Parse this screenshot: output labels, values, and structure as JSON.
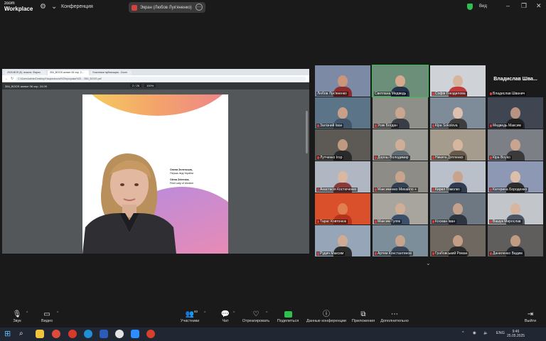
{
  "app": {
    "brand_top": "zoom",
    "brand_bottom": "Workplace",
    "conference_label": "Конференция"
  },
  "share_pill": {
    "label": "Экран (Любов Лук'яненко)"
  },
  "window": {
    "view_label": "Вид"
  },
  "browser": {
    "tabs": [
      "2025.BOS (5). вчасно. Фархи",
      "354_BOOS.затвит 06 спр. 2...",
      "Участники публикации - Zoom"
    ],
    "url": "C:/Users/admin/Desktop/Національна%20програма%20…/354_BOOS.pdf",
    "pdf_title": "354_BOOS затвит 06 спр. 24.09",
    "pdf_page": "2 / 26",
    "pdf_zoom": "100%"
  },
  "pdf_caption": {
    "name_ua": "Олена Зеленська,",
    "title_ua": "Перша леді України",
    "name_en": "Olena Zelenska,",
    "title_en": "First Lady of Ukraine"
  },
  "participants": [
    {
      "name": "Любов Лук'яненко",
      "muted": false,
      "bg": "#7d8aa5",
      "skin": "#c9957b",
      "shirt": "#8d2a2a"
    },
    {
      "name": "Светлана Медведь",
      "muted": false,
      "bg": "#6c8f79",
      "skin": "#d4a98e",
      "shirt": "#233149",
      "active": true
    },
    {
      "name": "Софія Гнездилова",
      "muted": true,
      "bg": "#cfd3d8",
      "skin": "#d8b49c",
      "shirt": "#c23b3b"
    },
    {
      "name": "Владислав Шва...",
      "full": "Владислав Шванич",
      "muted": true,
      "nameonly": true
    },
    {
      "name": "Залізний Іван",
      "muted": true,
      "bg": "#5c7488",
      "skin": "#c8a08a",
      "shirt": "#40546a"
    },
    {
      "name": "Усик Богдан",
      "muted": true,
      "bg": "#8f8f8a",
      "skin": "#caa690",
      "shirt": "#3a3d46"
    },
    {
      "name": "Кіра Sokolova",
      "muted": true,
      "bg": "#7e8b98",
      "skin": "#dcc0ad",
      "shirt": "#3d3d3d"
    },
    {
      "name": "Медведь Максим",
      "muted": true,
      "bg": "#3f4652",
      "skin": "#b89382",
      "shirt": "#222"
    },
    {
      "name": "Лутченко Ігор",
      "muted": true,
      "bg": "#5d5a55",
      "skin": "#c09a80",
      "shirt": "#2a2a2a"
    },
    {
      "name": "Дорош Володимир",
      "muted": true,
      "bg": "#9a9c95",
      "skin": "#cfae98",
      "shirt": "#5e6b73"
    },
    {
      "name": "Никита Дятленко",
      "muted": true,
      "bg": "#a59c8e",
      "skin": "#d6b69e",
      "shirt": "#665a4a"
    },
    {
      "name": "Кіра Boyko",
      "muted": true,
      "bg": "#7d7f87",
      "skin": "#c9a48f",
      "shirt": "#3a3a3a"
    },
    {
      "name": "Анастасія Костюченко",
      "muted": true,
      "bg": "#b0b6c2",
      "skin": "#d9b8a2",
      "shirt": "#8b3a3a"
    },
    {
      "name": "Максименко Михайло +",
      "muted": true,
      "bg": "#8e8c86",
      "skin": "#c9a48d",
      "shirt": "#314055"
    },
    {
      "name": "Кирил Гомолко",
      "muted": true,
      "bg": "#b9c0c9",
      "skin": "#caa38d",
      "shirt": "#2f3c52"
    },
    {
      "name": "Катерина Бороденко",
      "muted": true,
      "bg": "#8d99b4",
      "skin": "#dcbfab",
      "shirt": "#2d2d2d"
    },
    {
      "name": "Тарас Ковтонюк",
      "muted": true,
      "bg": "#d9502b",
      "skin": "#e07f4f",
      "shirt": "#b4331a"
    },
    {
      "name": "Максим Гуляк",
      "muted": true,
      "bg": "#a7a59e",
      "skin": "#cfae98",
      "shirt": "#3b4f6a"
    },
    {
      "name": "Косман Іван",
      "muted": true,
      "bg": "#6d7883",
      "skin": "#c5a08a",
      "shirt": "#2e3440"
    },
    {
      "name": "Вашук Мирослав",
      "muted": true,
      "bg": "#c2c6ca",
      "skin": "#d7b5a0",
      "shirt": "#4b5563"
    },
    {
      "name": "Рудич Максим",
      "muted": true,
      "bg": "#96a6b8",
      "skin": "#cfab93",
      "shirt": "#2c2c2c"
    },
    {
      "name": "Артем Константинов",
      "muted": true,
      "bg": "#7b8e99",
      "skin": "#c6a38c",
      "shirt": "#374456"
    },
    {
      "name": "Грабовський Роман",
      "muted": true,
      "bg": "#6e6860",
      "skin": "#c49d86",
      "shirt": "#2b2b2b"
    },
    {
      "name": "Даниленко Вадим",
      "muted": true,
      "bg": "#5f5e5c",
      "skin": "#c19a83",
      "shirt": "#23272e"
    }
  ],
  "toolbar": {
    "audio": "Звук",
    "video": "Видео",
    "participants": "Участники",
    "participants_count": "60",
    "chat": "Чат",
    "react": "Отреагировать",
    "share": "Поделиться",
    "info": "Данные конференции",
    "apps": "Приложения",
    "more": "Дополнительно",
    "leave": "Выйти"
  },
  "taskbar": {
    "lang": "ENG",
    "time": "9:46",
    "date": "25.05.2025"
  },
  "colors": {
    "share_green": "#2fbf4e",
    "mute_red": "#e23a3a",
    "bg_dark": "#1a1a1a"
  }
}
